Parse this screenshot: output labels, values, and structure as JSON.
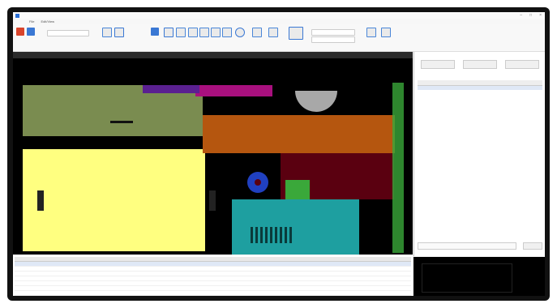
{
  "window": {
    "title": "",
    "controls": [
      "–",
      "□",
      "×"
    ]
  },
  "menu": {
    "items": [
      "File",
      "Edit/View"
    ]
  },
  "ribbon": {
    "tools": [
      {
        "name": "close-tool-icon",
        "color": "#d9442b"
      },
      {
        "name": "tool-icon",
        "color": "#3a78d4"
      },
      {
        "name": "copy-tool-icon",
        "color": "#4a86d8"
      },
      {
        "name": "shape-tool-icon",
        "color": "#3a78d4"
      },
      {
        "name": "zoom-in-icon",
        "color": "#4a86d8"
      },
      {
        "name": "zoom-out-icon",
        "color": "#4a86d8"
      },
      {
        "name": "zoom-fit-icon",
        "color": "#4a86d8"
      },
      {
        "name": "refresh-icon",
        "color": "#4a86d8"
      },
      {
        "name": "layers-icon",
        "color": "#3a78d4"
      },
      {
        "name": "settings-icon",
        "color": "#4a86d8"
      },
      {
        "name": "measure-icon",
        "color": "#4a86d8"
      }
    ]
  },
  "colors": {
    "olive": "#7a8c50",
    "yellow": "#ffff80",
    "orange": "#b5560f",
    "teal": "#1e9fa0",
    "maroon": "#5a0010",
    "magenta": "#a8107e",
    "green": "#3aa83a",
    "purple": "#5a2090",
    "gray": "#a8a8a8"
  }
}
